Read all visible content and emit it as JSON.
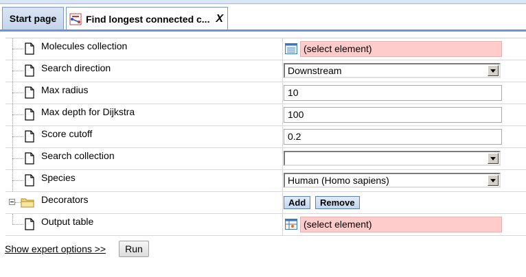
{
  "tabs": {
    "start_label": "Start page",
    "active_label": "Find longest connected c...",
    "close_label": "X"
  },
  "rows": [
    {
      "label": "Molecules collection",
      "type": "element",
      "value": "(select element)",
      "icon": "collection-icon"
    },
    {
      "label": "Search direction",
      "type": "select",
      "value": "Downstream"
    },
    {
      "label": "Max radius",
      "type": "text",
      "value": "10"
    },
    {
      "label": "Max depth for Dijkstra",
      "type": "text",
      "value": "100"
    },
    {
      "label": "Score cutoff",
      "type": "text",
      "value": "0.2"
    },
    {
      "label": "Search collection",
      "type": "select",
      "value": ""
    },
    {
      "label": "Species",
      "type": "select",
      "value": "Human (Homo sapiens)"
    },
    {
      "label": "Decorators",
      "type": "buttons",
      "add_label": "Add",
      "remove_label": "Remove"
    },
    {
      "label": "Output table",
      "type": "element",
      "value": "(select element)",
      "icon": "table-icon"
    }
  ],
  "footer": {
    "expert_label": "Show expert options >>",
    "run_label": "Run"
  },
  "colors": {
    "required_field": "#ffcccc",
    "tab_border": "#7d97bf",
    "button_bg": "#c3d6ee"
  }
}
